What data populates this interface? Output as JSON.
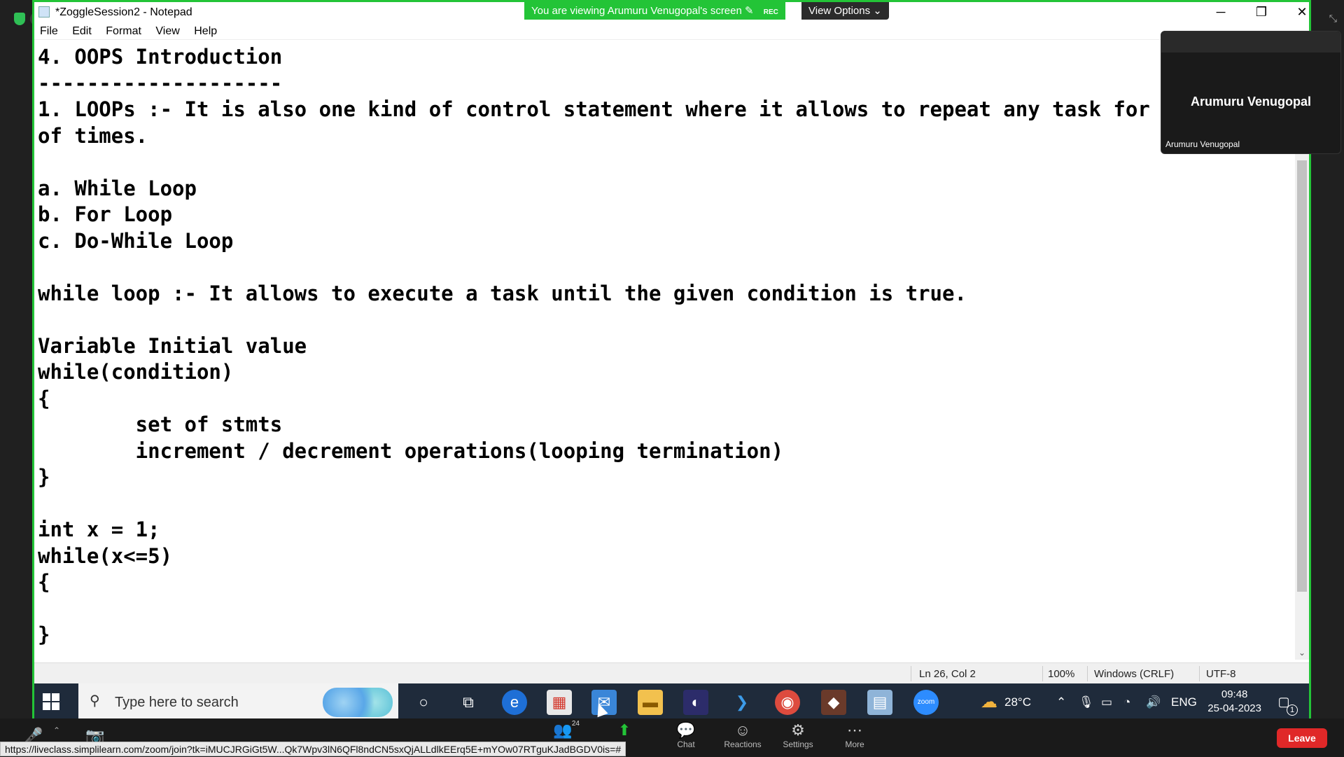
{
  "notepad": {
    "title": "*ZoggleSession2 - Notepad",
    "menu": [
      "File",
      "Edit",
      "Format",
      "View",
      "Help"
    ],
    "content": "4. OOPS Introduction\n--------------------\n1. LOOPs :- It is also one kind of control statement where it allows to repeat any task for n\nof times.\n\na. While Loop\nb. For Loop\nc. Do-While Loop\n\nwhile loop :- It allows to execute a task until the given condition is true.\n\nVariable Initial value\nwhile(condition)\n{\n        set of stmts\n        increment / decrement operations(looping termination)\n}\n\nint x = 1;\nwhile(x<=5)\n{\n\n}",
    "status": {
      "position": "Ln 26, Col 2",
      "zoom": "100%",
      "line_endings": "Windows (CRLF)",
      "encoding": "UTF-8"
    }
  },
  "zoom": {
    "rec_label": "REC",
    "viewing_banner": "You are viewing Arumuru Venugopal's screen",
    "view_options": "View Options",
    "participant_name": "Arumuru Venugopal",
    "participant_label": "Arumuru Venugopal",
    "participants_count": "24",
    "bottom_buttons": [
      "Chat",
      "Reactions",
      "Settings",
      "More"
    ],
    "leave_label": "Leave",
    "status_url": "https://liveclass.simplilearn.com/zoom/join?tk=iMUCJRGiGt5W...Qk7Wpv3lN6QFl8ndCN5sxQjALLdlkEErq5E+mYOw07RTguKJadBGDV0is=#"
  },
  "taskbar": {
    "search_placeholder": "Type here to search",
    "weather": "28°C",
    "language": "ENG",
    "time": "09:48",
    "date": "25-04-2023",
    "notification_count": "1"
  },
  "colors": {
    "share_border": "#23c437",
    "taskbar_bg": "#1f2b3b",
    "leave_red": "#e02828"
  }
}
